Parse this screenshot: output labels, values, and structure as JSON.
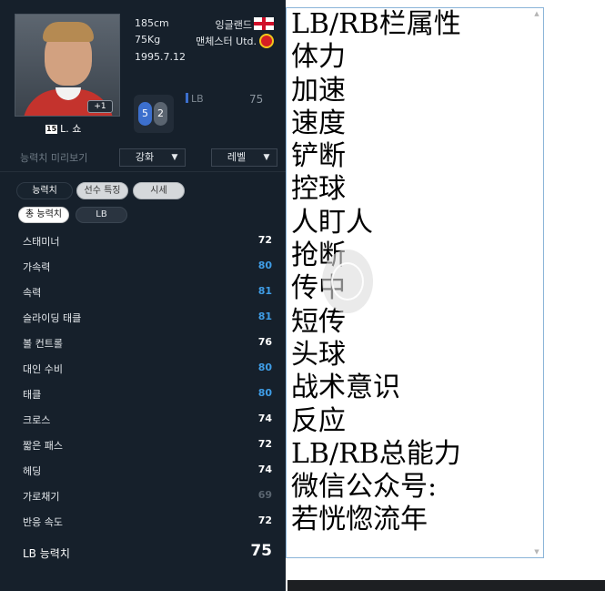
{
  "player": {
    "height": "185cm",
    "weight": "75Kg",
    "birthdate": "1995.7.12",
    "country": "잉글랜드",
    "club": "맨체스터 Utd.",
    "number": "15",
    "name": "L. 쇼",
    "plus_badge": "+1",
    "weak_foot_left": "5",
    "weak_foot_right": "2",
    "position": "LB",
    "position_rating": "75"
  },
  "preview": {
    "label": "능력치 미리보기",
    "enhance_label": "강화",
    "level_label": "레벨",
    "arrow": "▼"
  },
  "tabs": [
    {
      "label": "능력치"
    },
    {
      "label": "선수 특징"
    },
    {
      "label": "시세"
    }
  ],
  "subtabs": [
    {
      "label": "총 능력치"
    },
    {
      "label": "LB"
    }
  ],
  "stats": [
    {
      "label": "스태미너",
      "value": "72",
      "tone": "white"
    },
    {
      "label": "가속력",
      "value": "80",
      "tone": "blue"
    },
    {
      "label": "속력",
      "value": "81",
      "tone": "blue"
    },
    {
      "label": "슬라이딩 태클",
      "value": "81",
      "tone": "blue"
    },
    {
      "label": "볼 컨트롤",
      "value": "76",
      "tone": "white"
    },
    {
      "label": "대인 수비",
      "value": "80",
      "tone": "blue"
    },
    {
      "label": "태클",
      "value": "80",
      "tone": "blue"
    },
    {
      "label": "크로스",
      "value": "74",
      "tone": "white"
    },
    {
      "label": "짧은 패스",
      "value": "72",
      "tone": "white"
    },
    {
      "label": "헤딩",
      "value": "74",
      "tone": "white"
    },
    {
      "label": "가로채기",
      "value": "69",
      "tone": "gray"
    },
    {
      "label": "반응 속도",
      "value": "72",
      "tone": "white"
    }
  ],
  "total": {
    "label": "LB 능력치",
    "value": "75"
  },
  "document": {
    "lines": [
      "LB/RB栏属性",
      "体力",
      "加速",
      "速度",
      "铲断",
      "控球",
      "人盯人",
      "抢断",
      "传中",
      "短传",
      "头球",
      "战术意识",
      "反应",
      "LB/RB总能力",
      "微信公众号:",
      "若恍惚流年"
    ],
    "scroll_up": "▲",
    "scroll_down": "▼"
  },
  "colors": {
    "panel_bg": "#16202b",
    "stat_blue": "#3f9de6",
    "stat_white": "#ffffff",
    "stat_gray": "#5a6570",
    "window_border": "#8ab4d8"
  },
  "icons": [
    "england-flag-icon",
    "club-crest-icon",
    "weak-foot-icon",
    "scroll-arrow-icon"
  ]
}
